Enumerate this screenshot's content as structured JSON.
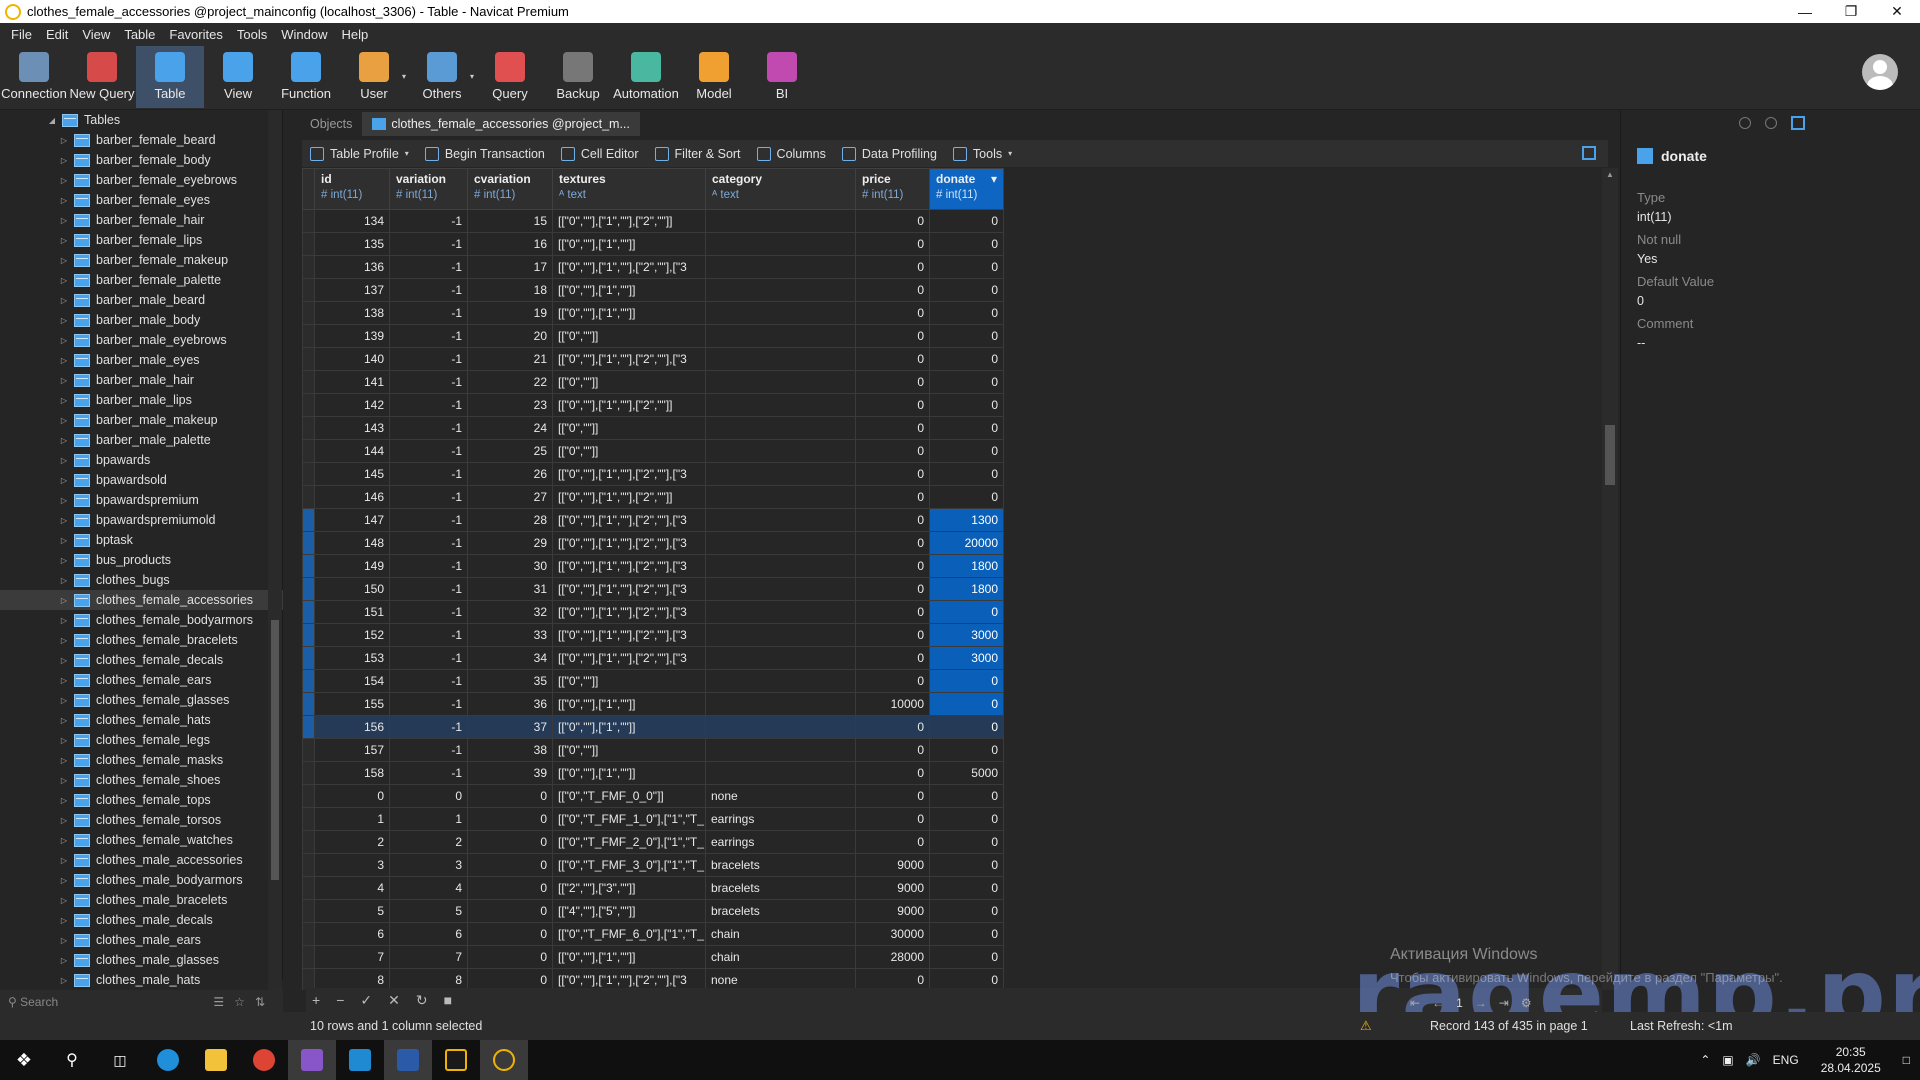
{
  "window": {
    "title": "clothes_female_accessories @project_mainconfig (localhost_3306) - Table - Navicat Premium"
  },
  "menu": [
    "File",
    "Edit",
    "View",
    "Table",
    "Favorites",
    "Tools",
    "Window",
    "Help"
  ],
  "toolbar": [
    {
      "label": "Connection",
      "icon": "connection-icon",
      "color": "#6c8fb5"
    },
    {
      "label": "New Query",
      "icon": "new-query-icon",
      "color": "#d64a4a"
    },
    {
      "label": "Table",
      "icon": "table-icon",
      "color": "#4aa3ea",
      "active": true
    },
    {
      "label": "View",
      "icon": "view-icon",
      "color": "#4aa3ea"
    },
    {
      "label": "Function",
      "icon": "function-icon",
      "color": "#4aa3ea"
    },
    {
      "label": "User",
      "icon": "user-icon",
      "color": "#e8a040",
      "caret": true
    },
    {
      "label": "Others",
      "icon": "others-icon",
      "color": "#5a9bd5",
      "caret": true
    },
    {
      "label": "Query",
      "icon": "query-icon",
      "color": "#e05050"
    },
    {
      "label": "Backup",
      "icon": "backup-icon",
      "color": "#777777"
    },
    {
      "label": "Automation",
      "icon": "automation-icon",
      "color": "#4ab8a0"
    },
    {
      "label": "Model",
      "icon": "model-icon",
      "color": "#f0a030"
    },
    {
      "label": "BI",
      "icon": "bi-icon",
      "color": "#c04ab0"
    }
  ],
  "sidebar": {
    "root": "Tables",
    "items": [
      "barber_female_beard",
      "barber_female_body",
      "barber_female_eyebrows",
      "barber_female_eyes",
      "barber_female_hair",
      "barber_female_lips",
      "barber_female_makeup",
      "barber_female_palette",
      "barber_male_beard",
      "barber_male_body",
      "barber_male_eyebrows",
      "barber_male_eyes",
      "barber_male_hair",
      "barber_male_lips",
      "barber_male_makeup",
      "barber_male_palette",
      "bpawards",
      "bpawardsold",
      "bpawardspremium",
      "bpawardspremiumold",
      "bptask",
      "bus_products",
      "clothes_bugs",
      "clothes_female_accessories",
      "clothes_female_bodyarmors",
      "clothes_female_bracelets",
      "clothes_female_decals",
      "clothes_female_ears",
      "clothes_female_glasses",
      "clothes_female_hats",
      "clothes_female_legs",
      "clothes_female_masks",
      "clothes_female_shoes",
      "clothes_female_tops",
      "clothes_female_torsos",
      "clothes_female_watches",
      "clothes_male_accessories",
      "clothes_male_bodyarmors",
      "clothes_male_bracelets",
      "clothes_male_decals",
      "clothes_male_ears",
      "clothes_male_glasses",
      "clothes_male_hats"
    ],
    "selected_index": 23,
    "search_placeholder": "Search"
  },
  "tabs": {
    "objects": "Objects",
    "active": "clothes_female_accessories @project_m..."
  },
  "subtoolbar": [
    "Table Profile",
    "Begin Transaction",
    "Cell Editor",
    "Filter & Sort",
    "Columns",
    "Data Profiling",
    "Tools"
  ],
  "columns": [
    {
      "name": "id",
      "type": "int(11)"
    },
    {
      "name": "variation",
      "type": "int(11)"
    },
    {
      "name": "cvariation",
      "type": "int(11)"
    },
    {
      "name": "textures",
      "type": "text"
    },
    {
      "name": "category",
      "type": "text"
    },
    {
      "name": "price",
      "type": "int(11)"
    },
    {
      "name": "donate",
      "type": "int(11)"
    }
  ],
  "rows": [
    [
      "134",
      "-1",
      "15",
      "[[\"0\",\"\"],[\"1\",\"\"],[\"2\",\"\"]]",
      "",
      "0",
      "0"
    ],
    [
      "135",
      "-1",
      "16",
      "[[\"0\",\"\"],[\"1\",\"\"]]",
      "",
      "0",
      "0"
    ],
    [
      "136",
      "-1",
      "17",
      "[[\"0\",\"\"],[\"1\",\"\"],[\"2\",\"\"],[\"3",
      "",
      "0",
      "0"
    ],
    [
      "137",
      "-1",
      "18",
      "[[\"0\",\"\"],[\"1\",\"\"]]",
      "",
      "0",
      "0"
    ],
    [
      "138",
      "-1",
      "19",
      "[[\"0\",\"\"],[\"1\",\"\"]]",
      "",
      "0",
      "0"
    ],
    [
      "139",
      "-1",
      "20",
      "[[\"0\",\"\"]]",
      "",
      "0",
      "0"
    ],
    [
      "140",
      "-1",
      "21",
      "[[\"0\",\"\"],[\"1\",\"\"],[\"2\",\"\"],[\"3",
      "",
      "0",
      "0"
    ],
    [
      "141",
      "-1",
      "22",
      "[[\"0\",\"\"]]",
      "",
      "0",
      "0"
    ],
    [
      "142",
      "-1",
      "23",
      "[[\"0\",\"\"],[\"1\",\"\"],[\"2\",\"\"]]",
      "",
      "0",
      "0"
    ],
    [
      "143",
      "-1",
      "24",
      "[[\"0\",\"\"]]",
      "",
      "0",
      "0"
    ],
    [
      "144",
      "-1",
      "25",
      "[[\"0\",\"\"]]",
      "",
      "0",
      "0"
    ],
    [
      "145",
      "-1",
      "26",
      "[[\"0\",\"\"],[\"1\",\"\"],[\"2\",\"\"],[\"3",
      "",
      "0",
      "0"
    ],
    [
      "146",
      "-1",
      "27",
      "[[\"0\",\"\"],[\"1\",\"\"],[\"2\",\"\"]]",
      "",
      "0",
      "0"
    ],
    [
      "147",
      "-1",
      "28",
      "[[\"0\",\"\"],[\"1\",\"\"],[\"2\",\"\"],[\"3",
      "",
      "0",
      "1300"
    ],
    [
      "148",
      "-1",
      "29",
      "[[\"0\",\"\"],[\"1\",\"\"],[\"2\",\"\"],[\"3",
      "",
      "0",
      "20000"
    ],
    [
      "149",
      "-1",
      "30",
      "[[\"0\",\"\"],[\"1\",\"\"],[\"2\",\"\"],[\"3",
      "",
      "0",
      "1800"
    ],
    [
      "150",
      "-1",
      "31",
      "[[\"0\",\"\"],[\"1\",\"\"],[\"2\",\"\"],[\"3",
      "",
      "0",
      "1800"
    ],
    [
      "151",
      "-1",
      "32",
      "[[\"0\",\"\"],[\"1\",\"\"],[\"2\",\"\"],[\"3",
      "",
      "0",
      "0"
    ],
    [
      "152",
      "-1",
      "33",
      "[[\"0\",\"\"],[\"1\",\"\"],[\"2\",\"\"],[\"3",
      "",
      "0",
      "3000"
    ],
    [
      "153",
      "-1",
      "34",
      "[[\"0\",\"\"],[\"1\",\"\"],[\"2\",\"\"],[\"3",
      "",
      "0",
      "3000"
    ],
    [
      "154",
      "-1",
      "35",
      "[[\"0\",\"\"]]",
      "",
      "0",
      "0"
    ],
    [
      "155",
      "-1",
      "36",
      "[[\"0\",\"\"],[\"1\",\"\"]]",
      "",
      "10000",
      "0"
    ],
    [
      "156",
      "-1",
      "37",
      "[[\"0\",\"\"],[\"1\",\"\"]]",
      "",
      "0",
      "0"
    ],
    [
      "157",
      "-1",
      "38",
      "[[\"0\",\"\"]]",
      "",
      "0",
      "0"
    ],
    [
      "158",
      "-1",
      "39",
      "[[\"0\",\"\"],[\"1\",\"\"]]",
      "",
      "0",
      "5000"
    ],
    [
      "0",
      "0",
      "0",
      "[[\"0\",\"T_FMF_0_0\"]]",
      "none",
      "0",
      "0"
    ],
    [
      "1",
      "1",
      "0",
      "[[\"0\",\"T_FMF_1_0\"],[\"1\",\"T_",
      "earrings",
      "0",
      "0"
    ],
    [
      "2",
      "2",
      "0",
      "[[\"0\",\"T_FMF_2_0\"],[\"1\",\"T_",
      "earrings",
      "0",
      "0"
    ],
    [
      "3",
      "3",
      "0",
      "[[\"0\",\"T_FMF_3_0\"],[\"1\",\"T_",
      "bracelets",
      "9000",
      "0"
    ],
    [
      "4",
      "4",
      "0",
      "[[\"2\",\"\"],[\"3\",\"\"]]",
      "bracelets",
      "9000",
      "0"
    ],
    [
      "5",
      "5",
      "0",
      "[[\"4\",\"\"],[\"5\",\"\"]]",
      "bracelets",
      "9000",
      "0"
    ],
    [
      "6",
      "6",
      "0",
      "[[\"0\",\"T_FMF_6_0\"],[\"1\",\"T_",
      "chain",
      "30000",
      "0"
    ],
    [
      "7",
      "7",
      "0",
      "[[\"0\",\"\"],[\"1\",\"\"]]",
      "chain",
      "28000",
      "0"
    ],
    [
      "8",
      "8",
      "0",
      "[[\"0\",\"\"],[\"1\",\"\"],[\"2\",\"\"],[\"3",
      "none",
      "0",
      "0"
    ]
  ],
  "selected_rows": [
    13,
    14,
    15,
    16,
    17,
    18,
    19,
    20,
    21,
    22
  ],
  "current_row": 22,
  "inspector": {
    "field": "donate",
    "props": [
      {
        "k": "Type",
        "v": "int(11)"
      },
      {
        "k": "Not null",
        "v": "Yes"
      },
      {
        "k": "Default Value",
        "v": "0"
      },
      {
        "k": "Comment",
        "v": "--"
      }
    ]
  },
  "status": {
    "selection": "10 rows and 1 column selected",
    "record": "Record 143 of 435 in page 1",
    "refresh": "Last Refresh: <1m",
    "page": "1"
  },
  "watermark": {
    "line1": "Активация Windows",
    "line2": "Чтобы активировать Windows, перейдите в раздел \"Параметры\".",
    "brand": "ragemp.pro"
  },
  "tray": {
    "lang": "ENG",
    "time": "20:35",
    "date": "28.04.2025"
  }
}
